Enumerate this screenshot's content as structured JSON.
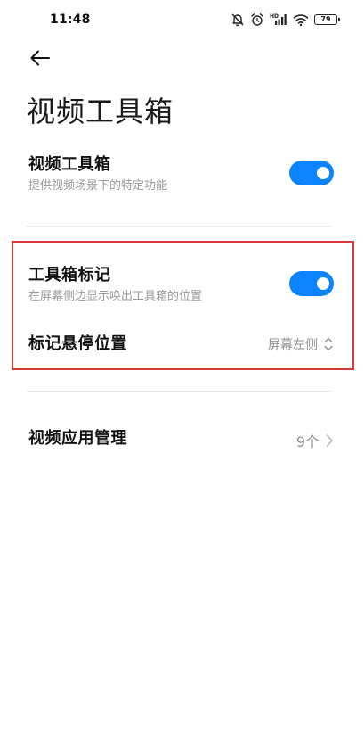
{
  "status_bar": {
    "time": "11:48",
    "battery_level": "79",
    "signal_label": "HD",
    "icons": [
      "alarm-off-icon",
      "alarm-clock-icon",
      "hd-signal-icon",
      "wifi-icon",
      "battery-icon"
    ]
  },
  "header": {
    "back_icon": "arrow-left-icon",
    "title": "视频工具箱"
  },
  "settings": {
    "video_toolbox": {
      "title": "视频工具箱",
      "subtitle": "提供视频场景下的特定功能",
      "enabled": true
    },
    "toolbox_marker": {
      "title": "工具箱标记",
      "subtitle": "在屏幕侧边显示唤出工具箱的位置",
      "enabled": true
    },
    "marker_position": {
      "title": "标记悬停位置",
      "value": "屏幕左侧",
      "icon": "up-down-chevron-icon"
    },
    "video_app_management": {
      "title": "视频应用管理",
      "value": "9个",
      "icon": "chevron-right-icon"
    }
  },
  "colors": {
    "accent": "#0d84ff",
    "highlight_border": "#d93a3a",
    "secondary_text": "#9a9a9a",
    "divider": "#e6e6e6"
  }
}
